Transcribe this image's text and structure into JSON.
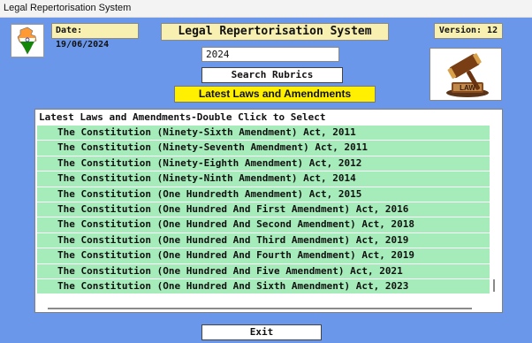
{
  "window": {
    "title": "Legal Repertorisation System"
  },
  "header": {
    "date_label": "Date: 19/06/2024",
    "app_title": "Legal Repertorisation System",
    "version_label": "Version: 12"
  },
  "search": {
    "year_value": "2024",
    "button_label": "Search Rubrics"
  },
  "banner": {
    "label": "Latest Laws and Amendments"
  },
  "gavel": {
    "label": "LAW"
  },
  "list": {
    "header": "Latest Laws and Amendments-Double Click to Select",
    "items": [
      "The Constitution (Ninety-Sixth Amendment) Act, 2011",
      "The Constitution (Ninety-Seventh Amendment) Act, 2011",
      "The Constitution (Ninety-Eighth Amendment) Act, 2012",
      "The Constitution (Ninety-Ninth Amendment) Act, 2014",
      "The Constitution (One Hundredth Amendment) Act, 2015",
      "The Constitution (One Hundred And First Amendment) Act, 2016",
      "The Constitution (One Hundred And Second Amendment) Act, 2018",
      "The Constitution (One Hundred And Third Amendment) Act, 2019",
      "The Constitution (One Hundred And Fourth Amendment) Act, 2019",
      "The Constitution (One Hundred And Five Amendment) Act, 2021",
      "The Constitution (One Hundred And Sixth Amendment) Act, 2023"
    ]
  },
  "footer": {
    "exit_label": "Exit"
  },
  "colors": {
    "window_bg": "#6b97ea",
    "title_box": "#f7f0b0",
    "banner": "#ffef00",
    "row_bg": "#a6ecba"
  },
  "icons": {
    "emblem": "india-map-emblem-icon",
    "gavel": "gavel-law-icon"
  }
}
